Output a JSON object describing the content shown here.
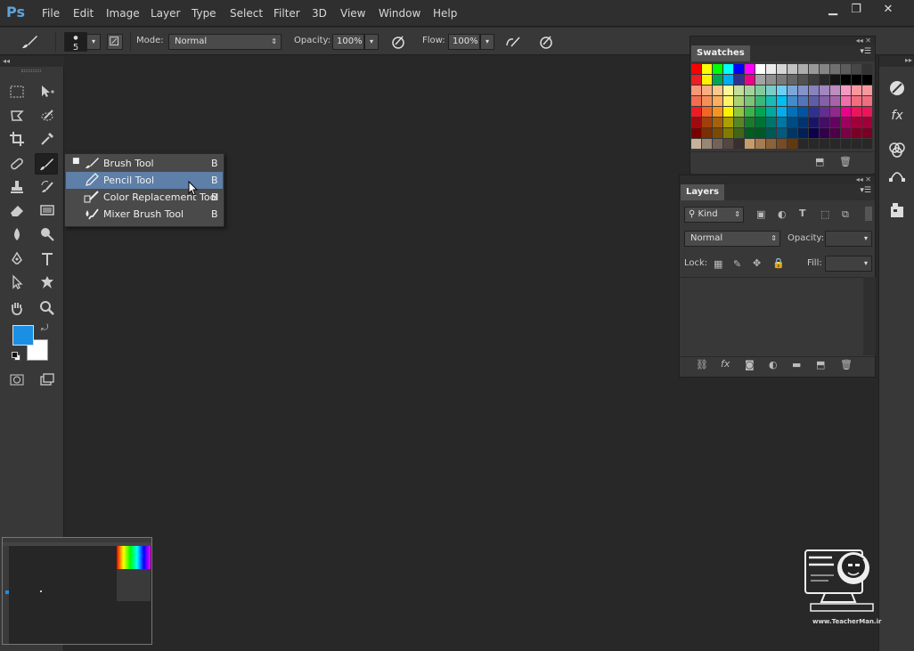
{
  "app": {
    "logo": "Ps"
  },
  "menu": [
    "File",
    "Edit",
    "Image",
    "Layer",
    "Type",
    "Select",
    "Filter",
    "3D",
    "View",
    "Window",
    "Help"
  ],
  "window_buttons": {
    "minimize": "▁",
    "restore": "❐",
    "close": "✕"
  },
  "options": {
    "brush_size": "5",
    "mode_label": "Mode:",
    "mode_value": "Normal",
    "opacity_label": "Opacity:",
    "opacity_value": "100%",
    "flow_label": "Flow:",
    "flow_value": "100%"
  },
  "flyout": {
    "items": [
      {
        "label": "Brush Tool",
        "shortcut": "B",
        "current": true
      },
      {
        "label": "Pencil Tool",
        "shortcut": "B",
        "selected": true
      },
      {
        "label": "Color Replacement Tool",
        "shortcut": "B"
      },
      {
        "label": "Mixer Brush Tool",
        "shortcut": "B"
      }
    ]
  },
  "colors": {
    "foreground": "#1a8fe3",
    "background": "#ffffff",
    "accent": "#5d7fa8"
  },
  "swatches": {
    "title": "Swatches",
    "rows": [
      [
        "#ff0000",
        "#ffff00",
        "#00ff00",
        "#00ffff",
        "#0000ff",
        "#ff00ff",
        "#ffffff",
        "#ebebeb",
        "#d6d6d6",
        "#c2c2c2",
        "#adadad",
        "#999999",
        "#858585",
        "#707070",
        "#5c5c5c",
        "#474747",
        "#333333"
      ],
      [
        "#ee1d24",
        "#fff200",
        "#00a650",
        "#00aeef",
        "#2e3192",
        "#ec008c",
        "#a3a3a3",
        "#8f8f8f",
        "#7a7a7a",
        "#666666",
        "#525252",
        "#3d3d3d",
        "#292929",
        "#141414",
        "#000000",
        "#000000",
        "#000000"
      ],
      [
        "#f7977a",
        "#f9ad81",
        "#fdc68a",
        "#fff79a",
        "#c4df9b",
        "#a3d39c",
        "#82ca9d",
        "#7bcdc8",
        "#6ecff6",
        "#7ea7d8",
        "#8493ca",
        "#8882be",
        "#a187be",
        "#bc8dbf",
        "#f49ac2",
        "#f6989d",
        "#f6989d"
      ],
      [
        "#f26c4f",
        "#f68e55",
        "#fbaf5c",
        "#fff467",
        "#acd372",
        "#7cc576",
        "#3bb878",
        "#1abbb4",
        "#00bff3",
        "#438ccb",
        "#5574b9",
        "#605ca8",
        "#855fa8",
        "#a763a8",
        "#f06ea9",
        "#f26d7d",
        "#f26d7d"
      ],
      [
        "#ed1c24",
        "#f26522",
        "#f7941d",
        "#fff200",
        "#8dc73f",
        "#39b54a",
        "#00a651",
        "#00a99d",
        "#00aeef",
        "#0072bc",
        "#0054a5",
        "#2e3192",
        "#662d91",
        "#92278f",
        "#ec008c",
        "#ed145b",
        "#ed145b"
      ],
      [
        "#9e0b0f",
        "#a0410d",
        "#a3620a",
        "#aba000",
        "#598527",
        "#197b30",
        "#007236",
        "#00746b",
        "#0076a3",
        "#004b80",
        "#003471",
        "#1b1464",
        "#440e62",
        "#630460",
        "#9e005d",
        "#9e0039",
        "#9e0039"
      ],
      [
        "#790000",
        "#7b2e00",
        "#7d4900",
        "#827b00",
        "#406618",
        "#005e20",
        "#005826",
        "#005952",
        "#005b7f",
        "#003663",
        "#002157",
        "#0d004c",
        "#32004b",
        "#4b0049",
        "#7b0046",
        "#7a0026",
        "#7a0026"
      ],
      [
        "#c7b299",
        "#998675",
        "#736357",
        "#534741",
        "#37302d",
        "#c69c6d",
        "#a67c52",
        "#8c6239",
        "#754c24",
        "#603913",
        "#282828",
        "#282828",
        "#282828",
        "#282828",
        "#282828",
        "#282828",
        "#282828"
      ]
    ]
  },
  "layers": {
    "title": "Layers",
    "kind_label": "Kind",
    "blend_value": "Normal",
    "opacity_label": "Opacity:",
    "lock_label": "Lock:",
    "fill_label": "Fill:"
  },
  "watermark": {
    "url": "www.TeacherMan.ir"
  }
}
